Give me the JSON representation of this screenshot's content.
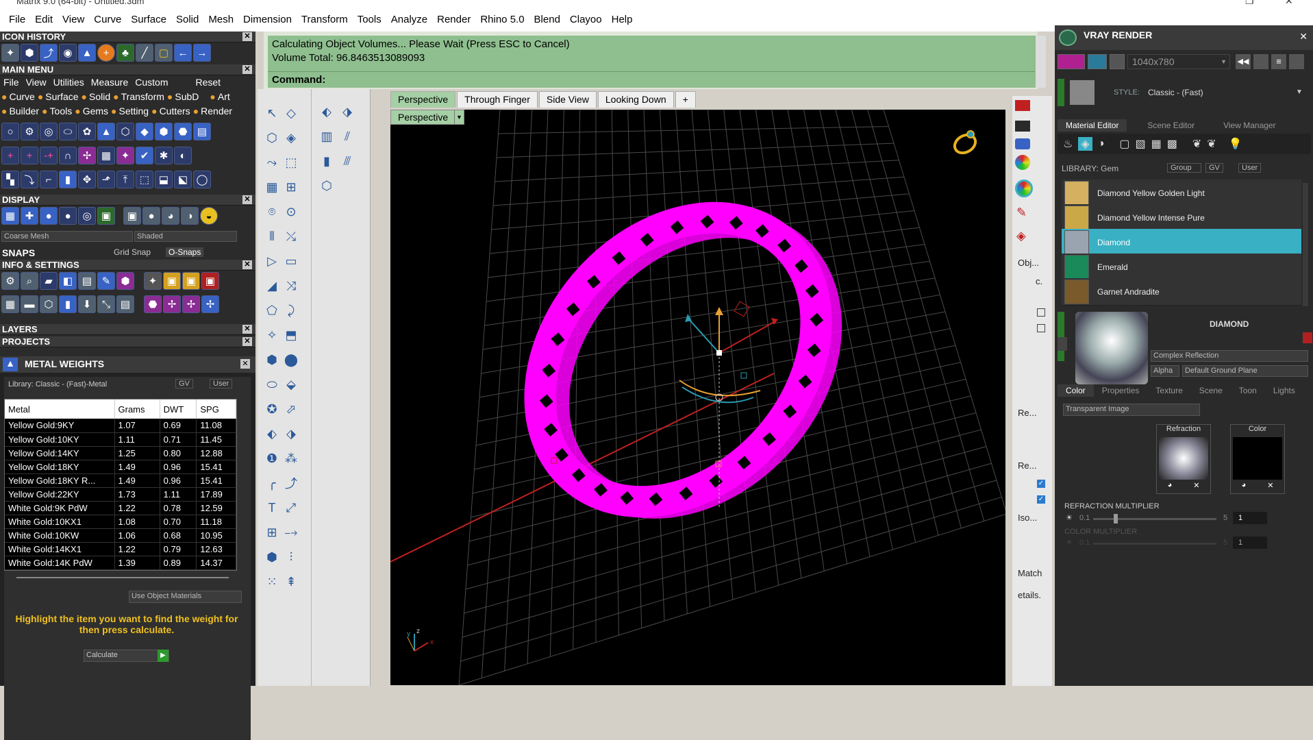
{
  "window": {
    "title": "Matrix 9.0 (64-bit) - Untitled.3dm"
  },
  "menubar": [
    "File",
    "Edit",
    "View",
    "Curve",
    "Surface",
    "Solid",
    "Mesh",
    "Dimension",
    "Transform",
    "Tools",
    "Analyze",
    "Render",
    "Rhino 5.0",
    "Blend",
    "Clayoo",
    "Help"
  ],
  "left": {
    "icon_history": "ICON HISTORY",
    "main_menu": "MAIN MENU",
    "submenu": [
      "File",
      "View",
      "Utilities",
      "Measure",
      "Custom",
      "Reset"
    ],
    "tags_row1": [
      "Curve",
      "Surface",
      "Solid",
      "Transform",
      "SubD",
      "Art"
    ],
    "tags_row2": [
      "Builder",
      "Tools",
      "Gems",
      "Setting",
      "Cutters",
      "Render"
    ],
    "display": "DISPLAY",
    "coarse_mesh": "Coarse Mesh",
    "shaded": "Shaded",
    "snaps": "SNAPS",
    "grid_snap": "Grid Snap",
    "osnaps": "O-Snaps",
    "info_settings": "INFO & SETTINGS",
    "layers": "LAYERS",
    "projects": "PROJECTS",
    "metal_weights": "METAL WEIGHTS",
    "library": "Library: Classic - (Fast)-Metal",
    "gv": "GV",
    "user": "User",
    "use_object_materials": "Use Object Materials",
    "highlight_msg": "Highlight the item you want to find the weight for then press calculate.",
    "calculate": "Calculate",
    "columns": [
      "Metal",
      "Grams",
      "DWT",
      "SPG"
    ],
    "rows": [
      [
        "Yellow Gold:9KY",
        "1.07",
        "0.69",
        "11.08"
      ],
      [
        "Yellow Gold:10KY",
        "1.11",
        "0.71",
        "11.45"
      ],
      [
        "Yellow Gold:14KY",
        "1.25",
        "0.80",
        "12.88"
      ],
      [
        "Yellow Gold:18KY",
        "1.49",
        "0.96",
        "15.41"
      ],
      [
        "Yellow Gold:18KY R...",
        "1.49",
        "0.96",
        "15.41"
      ],
      [
        "Yellow Gold:22KY",
        "1.73",
        "1.11",
        "17.89"
      ],
      [
        "White Gold:9K PdW",
        "1.22",
        "0.78",
        "12.59"
      ],
      [
        "White Gold:10KX1",
        "1.08",
        "0.70",
        "11.18"
      ],
      [
        "White Gold:10KW",
        "1.06",
        "0.68",
        "10.95"
      ],
      [
        "White Gold:14KX1",
        "1.22",
        "0.79",
        "12.63"
      ],
      [
        "White Gold:14K PdW",
        "1.39",
        "0.89",
        "14.37"
      ]
    ]
  },
  "command": {
    "line1": "Calculating Object Volumes... Please Wait (Press ESC to Cancel)",
    "line2": "Volume Total: 96.8463513089093",
    "prompt": "Command:"
  },
  "viewport": {
    "tabs": [
      "Perspective",
      "Through Finger",
      "Side View",
      "Looking Down"
    ],
    "add_tab": "+",
    "label": "Perspective",
    "mesh_color": "#ff00ff",
    "axis_x": "x",
    "axis_y": "y",
    "axis_z": "z"
  },
  "rtoolbar": [
    "Obj...",
    "c.",
    "Re...",
    "Re...",
    "Iso...",
    "Match",
    "etails."
  ],
  "vray": {
    "title": "VRAY RENDER",
    "resolution": "1040x780",
    "style_label": "STYLE:",
    "style_value": "Classic - (Fast)",
    "tabs": [
      "Material Editor",
      "Scene Editor",
      "View Manager"
    ],
    "library": "LIBRARY: Gem",
    "group": "Group",
    "gv": "GV",
    "user": "User",
    "materials": [
      "Diamond Yellow Golden Light",
      "Diamond Yellow Intense Pure",
      "Diamond",
      "Emerald",
      "Garnet Andradite"
    ],
    "selected_material": "Diamond",
    "material_name": "DIAMOND",
    "complex_reflection": "Complex Reflection",
    "alpha": "Alpha",
    "default_ground_plane": "Default Ground Plane",
    "prop_tabs": [
      "Color",
      "Properties",
      "Texture",
      "Scene",
      "Toon",
      "Lights"
    ],
    "transparent_image": "Transparent Image",
    "refraction": "Refraction",
    "color": "Color",
    "refraction_multiplier": "REFRACTION MULTIPLIER",
    "refr_min": "0.1",
    "refr_max": "5",
    "refr_val": "1",
    "color_multiplier": "COLOR MULTIPLIER",
    "col_min": "0.1",
    "col_max": "5",
    "col_val": "1"
  }
}
